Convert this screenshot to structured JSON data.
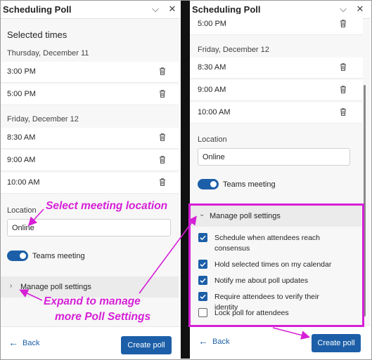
{
  "app_title": "Scheduling Poll",
  "icons": {
    "collapse": "chevron-down-icon",
    "close": "close-icon",
    "delete": "trash-icon",
    "expand": "chevron-right-icon",
    "back": "arrow-left-icon",
    "check": "checkmark-icon"
  },
  "colors": {
    "accent": "#1c5fa8",
    "annotation": "#d61fd6"
  },
  "left_panel": {
    "selected_times_heading": "Selected times",
    "days": [
      {
        "date": "Thursday, December 11",
        "times": [
          "3:00 PM",
          "5:00 PM"
        ]
      },
      {
        "date": "Friday, December 12",
        "times": [
          "8:30 AM",
          "9:00 AM",
          "10:00 AM"
        ]
      }
    ],
    "location_label": "Location",
    "location_value": "Online",
    "teams_meeting_label": "Teams meeting",
    "teams_meeting_on": true,
    "manage_label": "Manage poll settings",
    "back_label": "Back",
    "create_label": "Create poll"
  },
  "right_panel": {
    "top_time": "5:00 PM",
    "day_date": "Friday, December 12",
    "times": [
      "8:30 AM",
      "9:00 AM",
      "10:00 AM"
    ],
    "location_label": "Location",
    "location_value": "Online",
    "teams_meeting_label": "Teams meeting",
    "teams_meeting_on": true,
    "manage_label": "Manage poll settings",
    "settings": [
      {
        "label": "Schedule when attendees reach consensus",
        "checked": true
      },
      {
        "label": "Hold selected times on my calendar",
        "checked": true
      },
      {
        "label": "Notify me about poll updates",
        "checked": true
      },
      {
        "label": "Require attendees to verify their identity",
        "checked": true
      },
      {
        "label": "Lock poll for attendees",
        "checked": false
      }
    ],
    "back_label": "Back",
    "create_label": "Create poll"
  },
  "annotations": {
    "select_location": "Select meeting location",
    "expand_line1": "Expand to manage",
    "expand_line2": "more Poll Settings"
  }
}
